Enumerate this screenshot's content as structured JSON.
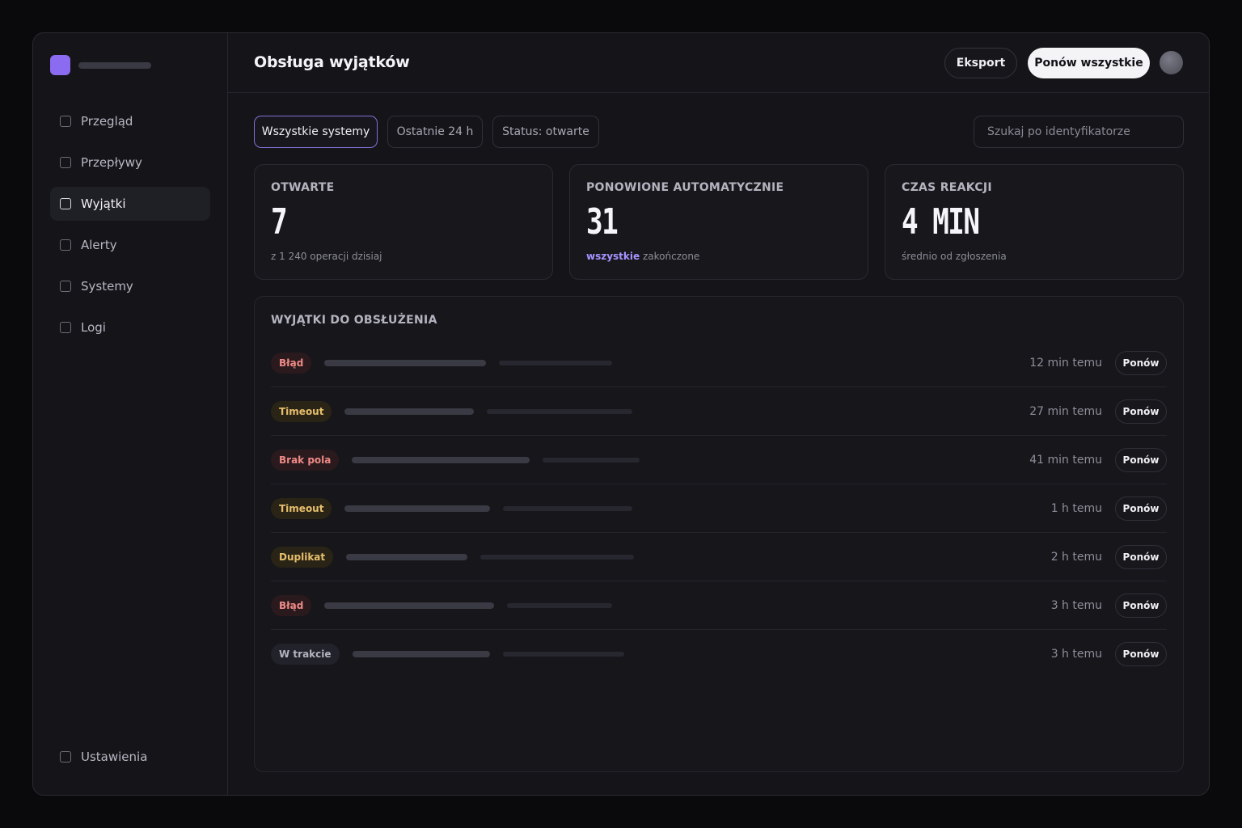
{
  "nav": {
    "items": [
      {
        "label": "Przegląd"
      },
      {
        "label": "Przepływy"
      },
      {
        "label": "Wyjątki"
      },
      {
        "label": "Alerty"
      },
      {
        "label": "Systemy"
      },
      {
        "label": "Logi"
      }
    ],
    "settings": "Ustawienia",
    "active_index": 2
  },
  "header": {
    "title": "Obsługa wyjątków",
    "export_label": "Eksport",
    "retry_all_label": "Ponów wszystkie"
  },
  "filters": {
    "systems": "Wszystkie systemy",
    "range": "Ostatnie 24 h",
    "status": "Status: otwarte",
    "search_placeholder": "Szukaj po identyfikatorze"
  },
  "stats": [
    {
      "label": "OTWARTE",
      "value": "7",
      "sub": "z 1 240 operacji dzisiaj"
    },
    {
      "label": "PONOWIONE AUTOMATYCZNIE",
      "value": "31",
      "sub_highlight": "wszystkie",
      "sub": " zakończone"
    },
    {
      "label": "CZAS REAKCJI",
      "value": "4 MIN",
      "sub": "średnio od zgłoszenia"
    }
  ],
  "table": {
    "title": "WYJĄTKI DO OBSŁUŻENIA",
    "retry_label": "Ponów",
    "rows": [
      {
        "status": "Błąd",
        "tone": "error",
        "time": "12 min temu"
      },
      {
        "status": "Timeout",
        "tone": "warn",
        "time": "27 min temu"
      },
      {
        "status": "Brak pola",
        "tone": "error",
        "time": "41 min temu"
      },
      {
        "status": "Timeout",
        "tone": "warn",
        "time": "1 h temu"
      },
      {
        "status": "Duplikat",
        "tone": "warn",
        "time": "2 h temu"
      },
      {
        "status": "Błąd",
        "tone": "error",
        "time": "3 h temu"
      },
      {
        "status": "W trakcie",
        "tone": "neutral",
        "time": "3 h temu"
      }
    ]
  },
  "colors": {
    "accent": "#8b6cf0",
    "error": "#ef8a86",
    "warning": "#e7bf6c",
    "highlight": "#a893ff"
  }
}
